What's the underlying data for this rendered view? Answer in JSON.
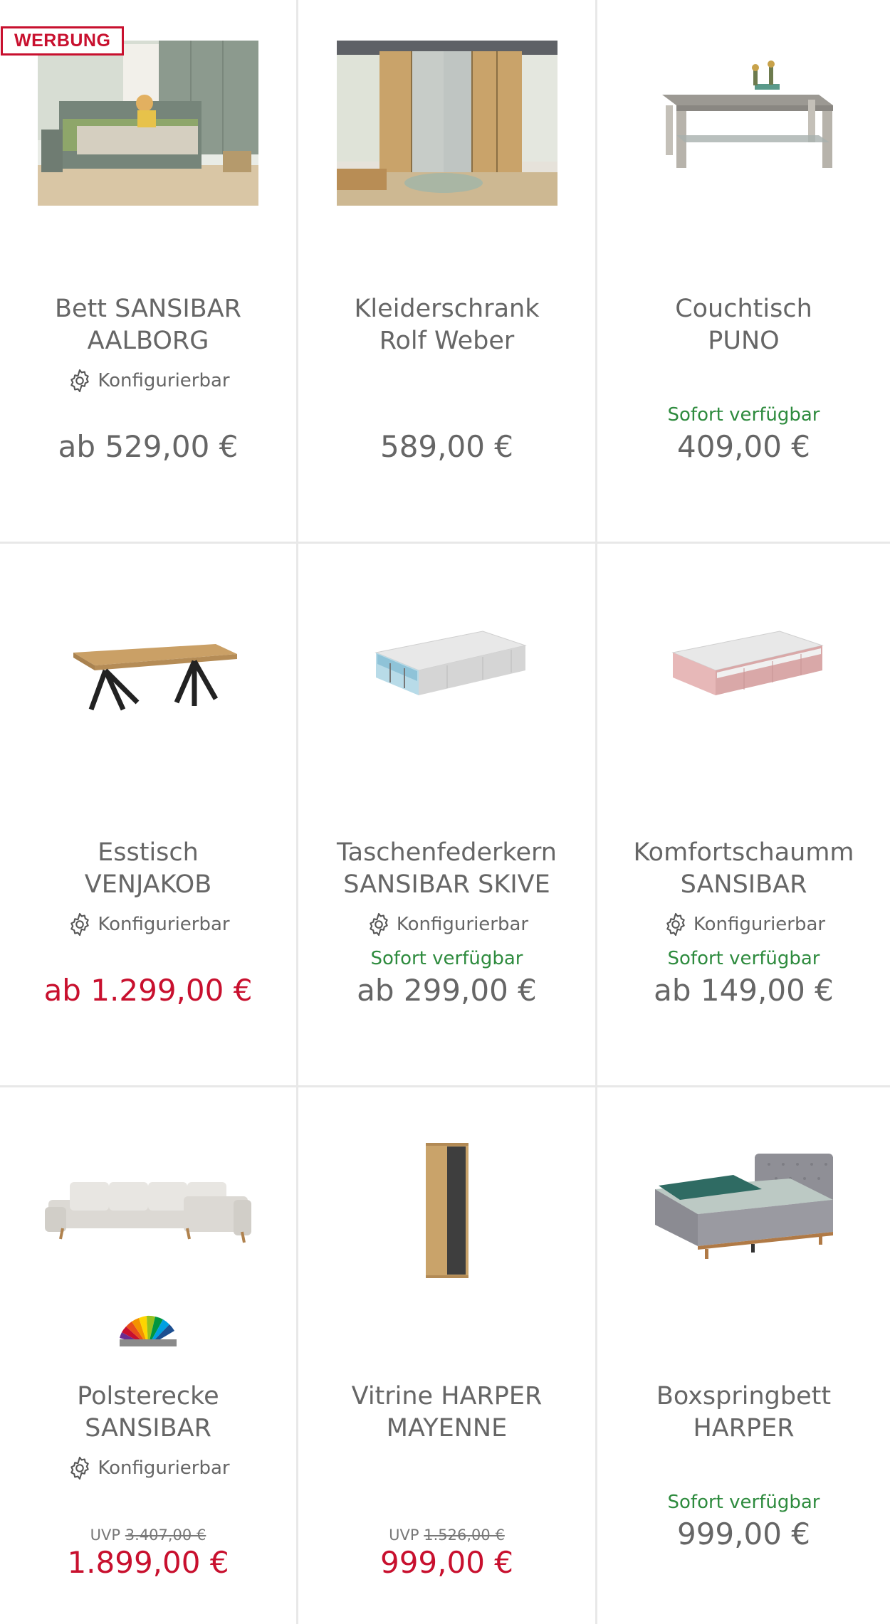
{
  "ad_badge": "WERBUNG",
  "colors": {
    "sale": "#c8102e",
    "available": "#2e8b3e",
    "text": "#666666",
    "divider": "#e8e8e8"
  },
  "products": [
    {
      "title_line1": "Bett SANSIBAR",
      "title_line2": "AALBORG",
      "config": "Konfigurierbar",
      "availability": "",
      "uvp_label": "",
      "uvp_price": "",
      "price": "ab 529,00 €",
      "price_sale": false,
      "image": "bed-photo"
    },
    {
      "title_line1": "Kleiderschrank",
      "title_line2": "Rolf Weber",
      "config": "",
      "availability": "",
      "uvp_label": "",
      "uvp_price": "",
      "price": "589,00 €",
      "price_sale": false,
      "image": "wardrobe-photo"
    },
    {
      "title_line1": "Couchtisch",
      "title_line2": "PUNO",
      "config": "",
      "availability": "Sofort verfügbar",
      "uvp_label": "",
      "uvp_price": "",
      "price": "409,00 €",
      "price_sale": false,
      "image": "coffee-table-photo"
    },
    {
      "title_line1": "Esstisch",
      "title_line2": "VENJAKOB",
      "config": "Konfigurierbar",
      "availability": "",
      "uvp_label": "",
      "uvp_price": "",
      "price": "ab 1.299,00 €",
      "price_sale": true,
      "image": "dining-table-photo"
    },
    {
      "title_line1": "Taschenfederkern",
      "title_line2": "SANSIBAR SKIVE",
      "config": "Konfigurierbar",
      "availability": "Sofort verfügbar",
      "uvp_label": "",
      "uvp_price": "",
      "price": "ab 299,00 €",
      "price_sale": false,
      "image": "pocket-spring-mattress-photo"
    },
    {
      "title_line1": "Komfortschaumm",
      "title_line2": "SANSIBAR",
      "config": "Konfigurierbar",
      "availability": "Sofort verfügbar",
      "uvp_label": "",
      "uvp_price": "",
      "price": "ab 149,00 €",
      "price_sale": false,
      "image": "foam-mattress-photo"
    },
    {
      "title_line1": "Polsterecke",
      "title_line2": "SANSIBAR",
      "config": "Konfigurierbar",
      "availability": "",
      "uvp_label": "UVP",
      "uvp_price": "3.407,00 €",
      "price": "1.899,00 €",
      "price_sale": true,
      "image": "corner-sofa-photo"
    },
    {
      "title_line1": "Vitrine HARPER",
      "title_line2": "MAYENNE",
      "config": "",
      "availability": "",
      "uvp_label": "UVP",
      "uvp_price": "1.526,00 €",
      "price": "999,00 €",
      "price_sale": true,
      "image": "vitrine-photo"
    },
    {
      "title_line1": "Boxspringbett",
      "title_line2": "HARPER",
      "config": "",
      "availability": "Sofort verfügbar",
      "uvp_label": "",
      "uvp_price": "",
      "price": "999,00 €",
      "price_sale": false,
      "image": "boxspring-bed-photo"
    }
  ]
}
